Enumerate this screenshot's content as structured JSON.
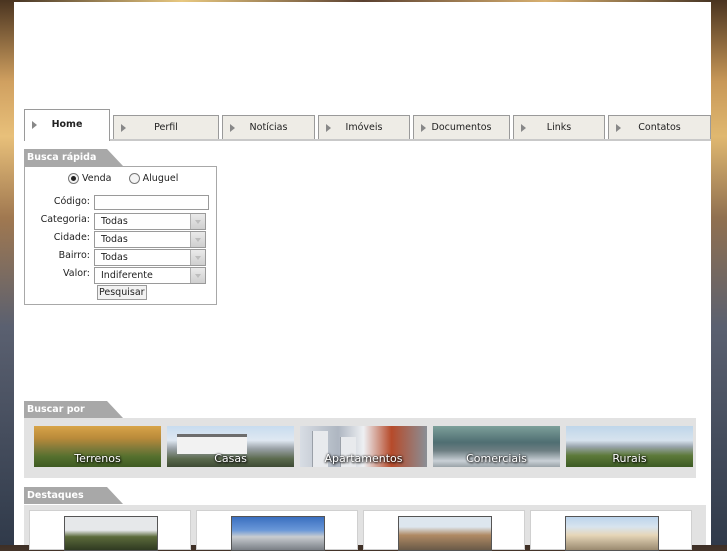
{
  "nav": {
    "tabs": [
      {
        "label": "Home",
        "active": true
      },
      {
        "label": "Perfil"
      },
      {
        "label": "Notícias"
      },
      {
        "label": "Imóveis"
      },
      {
        "label": "Documentos"
      },
      {
        "label": "Links"
      },
      {
        "label": "Contatos"
      }
    ]
  },
  "quick_search": {
    "title": "Busca rápida",
    "radio_venda": "Venda",
    "radio_aluguel": "Aluguel",
    "selected": "Venda",
    "codigo_label": "Código:",
    "codigo_value": "",
    "categoria_label": "Categoria:",
    "categoria_value": "Todas",
    "cidade_label": "Cidade:",
    "cidade_value": "Todas",
    "bairro_label": "Bairro:",
    "bairro_value": "Todas",
    "valor_label": "Valor:",
    "valor_value": "Indiferente",
    "submit_label": "Pesquisar"
  },
  "browse": {
    "title": "Buscar por",
    "categories": [
      "Terrenos",
      "Casas",
      "Apartamentos",
      "Comerciais",
      "Rurais"
    ]
  },
  "featured": {
    "title": "Destaques"
  },
  "colors": {
    "section_header": "#a8a8a8",
    "tab_inactive": "#eeece6",
    "strip_bg": "#e2e2e2"
  }
}
